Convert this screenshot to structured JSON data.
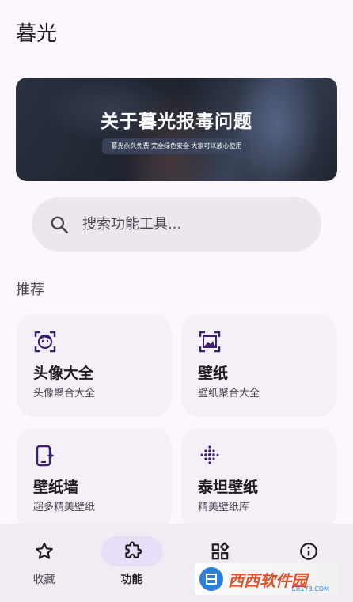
{
  "app": {
    "title": "暮光"
  },
  "banner": {
    "title": "关于暮光报毒问题",
    "subtitle": "暮光永久免费 完全绿色安全 大家可以放心使用"
  },
  "search": {
    "placeholder": "搜索功能工具..."
  },
  "section": {
    "title": "推荐"
  },
  "cards": [
    {
      "title": "头像大全",
      "desc": "头像聚合大全",
      "icon": "face-icon"
    },
    {
      "title": "壁纸",
      "desc": "壁纸聚合大全",
      "icon": "image-frame-icon"
    },
    {
      "title": "壁纸墙",
      "desc": "超多精美壁纸",
      "icon": "phone-sparkle-icon"
    },
    {
      "title": "泰坦壁纸",
      "desc": "精美壁纸库",
      "icon": "dots-grid-icon"
    }
  ],
  "nav": [
    {
      "label": "收藏",
      "icon": "star-icon",
      "active": false
    },
    {
      "label": "功能",
      "icon": "puzzle-icon",
      "active": true
    },
    {
      "label": "",
      "icon": "widgets-icon",
      "active": false
    },
    {
      "label": "",
      "icon": "info-icon",
      "active": false
    }
  ],
  "watermark": {
    "text": "西西软件园",
    "url": "CR173.COM"
  },
  "colors": {
    "background": "#fcf6fd",
    "card": "#f5eff7",
    "accent": "#3b1f6e",
    "active_pill": "#e8def8"
  }
}
